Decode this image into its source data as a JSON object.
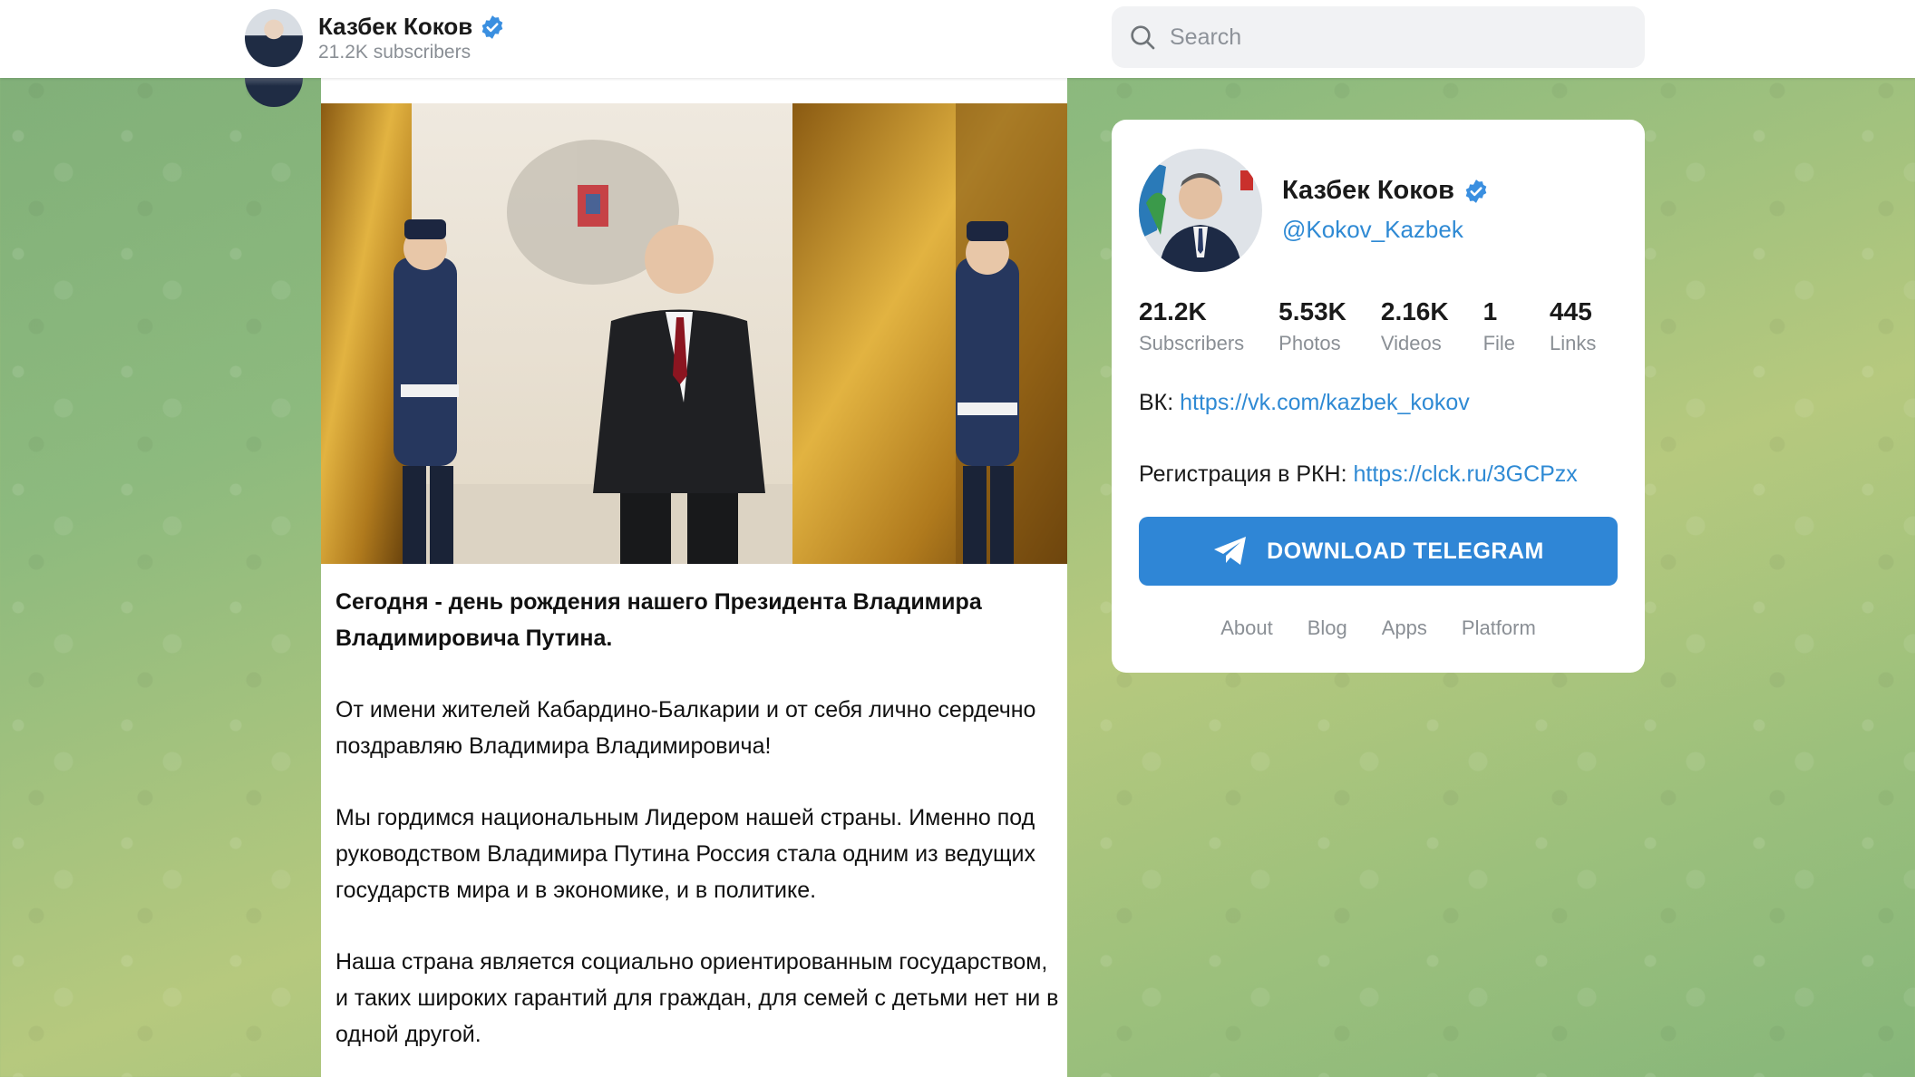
{
  "header": {
    "channel_name": "Казбек Коков",
    "subscribers": "21.2K subscribers",
    "search_placeholder": "Search"
  },
  "post": {
    "paragraphs": [
      "Сегодня - день рождения нашего Президента Владимира Владимировича Путина.",
      "От имени жителей Кабардино-Балкарии и от себя лично сердечно поздравляю Владимира Владимировича!",
      "Мы гордимся национальным Лидером нашей страны. Именно под руководством Владимира Путина Россия стала одним из ведущих государств мира и в экономике, и в политике.",
      "Наша страна является социально ориентированным государством, и таких широких гарантий для граждан, для семей с детьми нет ни в одной другой."
    ]
  },
  "profile": {
    "name": "Казбек Коков",
    "handle": "@Kokov_Kazbek",
    "stats": [
      {
        "value": "21.2K",
        "label": "Subscribers"
      },
      {
        "value": "5.53K",
        "label": "Photos"
      },
      {
        "value": "2.16K",
        "label": "Videos"
      },
      {
        "value": "1",
        "label": "File"
      },
      {
        "value": "445",
        "label": "Links"
      }
    ],
    "vk_label": "ВК:",
    "vk_link": "https://vk.com/kazbek_kokov",
    "rkn_label": "Регистрация в РКН:",
    "rkn_link": "https://clck.ru/3GCPzx",
    "download_label": "DOWNLOAD TELEGRAM",
    "footer_links": [
      "About",
      "Blog",
      "Apps",
      "Platform"
    ]
  },
  "colors": {
    "accent": "#2f86d6",
    "link": "#2f8ad4",
    "verified": "#3a8fe0"
  }
}
